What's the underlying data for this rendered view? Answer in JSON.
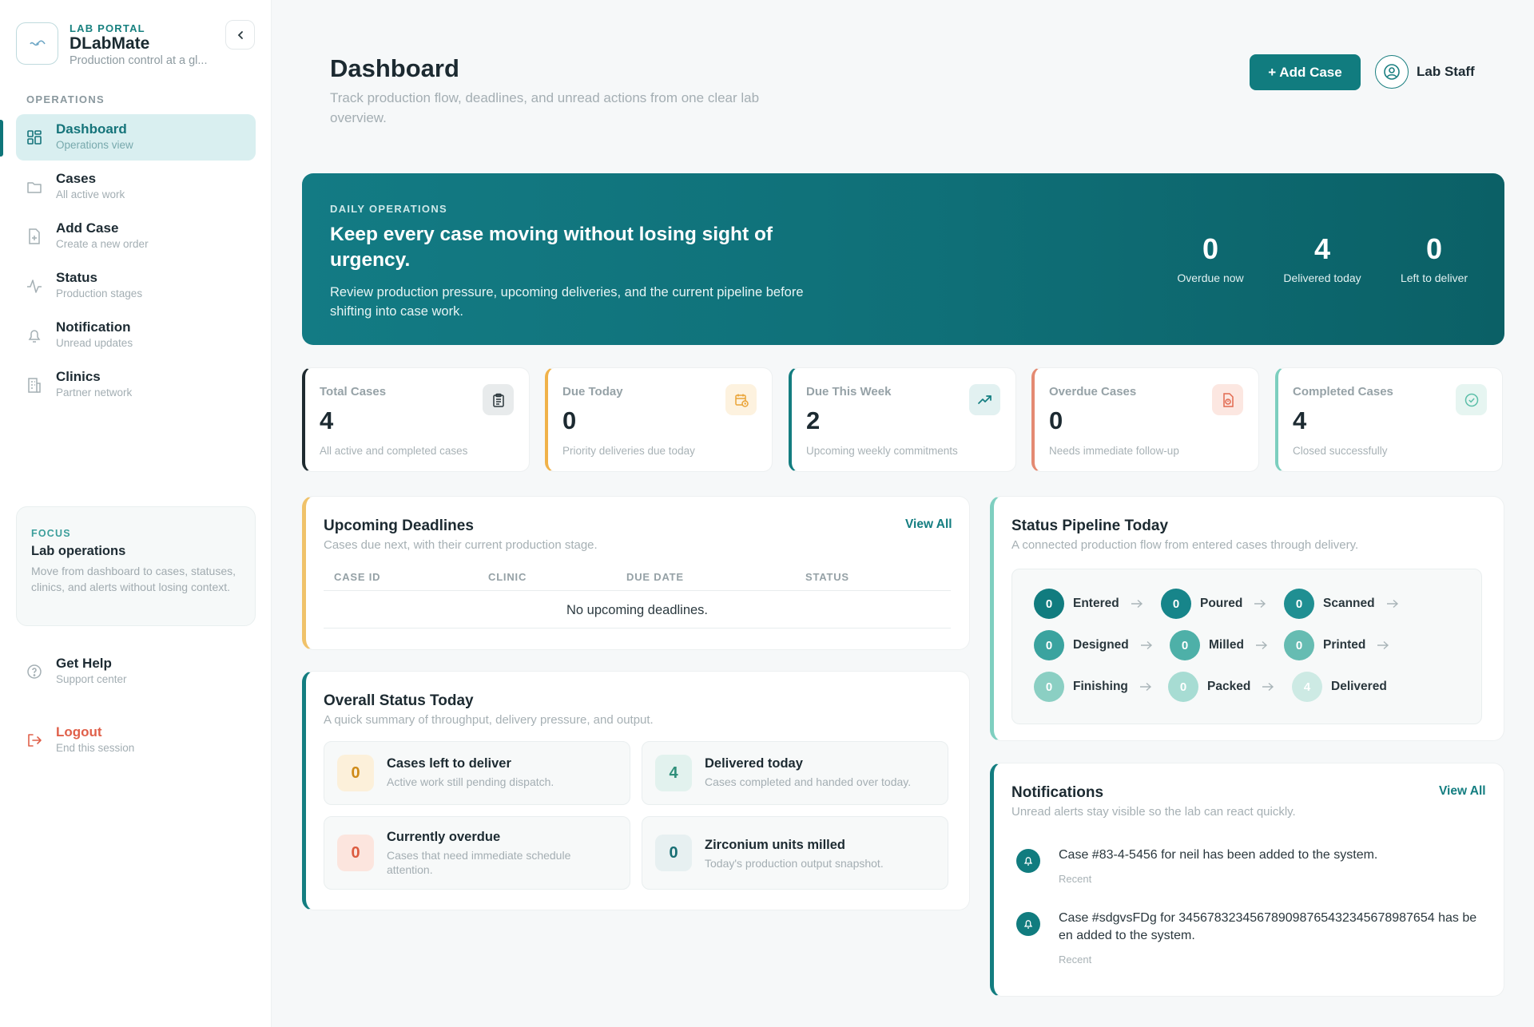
{
  "brand": {
    "kicker": "LAB PORTAL",
    "name": "DLabMate",
    "subtitle": "Production control at a gl..."
  },
  "sidebar": {
    "section_label": "OPERATIONS",
    "items": [
      {
        "title": "Dashboard",
        "subtitle": "Operations view",
        "icon": "grid-icon"
      },
      {
        "title": "Cases",
        "subtitle": "All active work",
        "icon": "folder-icon"
      },
      {
        "title": "Add Case",
        "subtitle": "Create a new order",
        "icon": "file-plus-icon"
      },
      {
        "title": "Status",
        "subtitle": "Production stages",
        "icon": "activity-icon"
      },
      {
        "title": "Notification",
        "subtitle": "Unread updates",
        "icon": "bell-icon"
      },
      {
        "title": "Clinics",
        "subtitle": "Partner network",
        "icon": "building-icon"
      }
    ],
    "focus": {
      "kicker": "FOCUS",
      "title": "Lab operations",
      "text": "Move from dashboard to cases, statuses, clinics, and alerts without losing context."
    },
    "help": {
      "title": "Get Help",
      "subtitle": "Support center"
    },
    "logout": {
      "title": "Logout",
      "subtitle": "End this session"
    }
  },
  "header": {
    "title": "Dashboard",
    "subtitle": "Track production flow, deadlines, and unread actions from one clear lab overview.",
    "add_case_label": "+ Add Case",
    "user_name": "Lab Staff"
  },
  "hero": {
    "kicker": "DAILY OPERATIONS",
    "title": "Keep every case moving without losing sight of urgency.",
    "text": "Review production pressure, upcoming deliveries, and the current pipeline before shifting into case work.",
    "stats": [
      {
        "value": "0",
        "label": "Overdue now"
      },
      {
        "value": "4",
        "label": "Delivered today"
      },
      {
        "value": "0",
        "label": "Left to deliver"
      }
    ]
  },
  "stat_cards": [
    {
      "label": "Total Cases",
      "value": "4",
      "note": "All active and completed cases",
      "accent": "#1f2b30",
      "icon": "clipboard-icon"
    },
    {
      "label": "Due Today",
      "value": "0",
      "note": "Priority deliveries due today",
      "accent": "#f0b24a",
      "icon": "calendar-clock-icon"
    },
    {
      "label": "Due This Week",
      "value": "2",
      "note": "Upcoming weekly commitments",
      "accent": "#137d80",
      "icon": "trending-up-icon"
    },
    {
      "label": "Overdue Cases",
      "value": "0",
      "note": "Needs immediate follow-up",
      "accent": "#e48a72",
      "icon": "alert-file-icon"
    },
    {
      "label": "Completed Cases",
      "value": "4",
      "note": "Closed successfully",
      "accent": "#7ccfbf",
      "icon": "check-circle-icon"
    }
  ],
  "deadlines": {
    "title": "Upcoming Deadlines",
    "subtitle": "Cases due next, with their current production stage.",
    "view_all": "View All",
    "columns": [
      "CASE ID",
      "CLINIC",
      "DUE DATE",
      "STATUS"
    ],
    "empty": "No upcoming deadlines."
  },
  "overall": {
    "title": "Overall Status Today",
    "subtitle": "A quick summary of throughput, delivery pressure, and output.",
    "cards": [
      {
        "value": "0",
        "title": "Cases left to deliver",
        "subtitle": "Active work still pending dispatch."
      },
      {
        "value": "4",
        "title": "Delivered today",
        "subtitle": "Cases completed and handed over today."
      },
      {
        "value": "0",
        "title": "Currently overdue",
        "subtitle": "Cases that need immediate schedule attention."
      },
      {
        "value": "0",
        "title": "Zirconium units milled",
        "subtitle": "Today's production output snapshot."
      }
    ]
  },
  "pipeline": {
    "title": "Status Pipeline Today",
    "subtitle": "A connected production flow from entered cases through delivery.",
    "stages": [
      {
        "count": "0",
        "label": "Entered"
      },
      {
        "count": "0",
        "label": "Poured"
      },
      {
        "count": "0",
        "label": "Scanned"
      },
      {
        "count": "0",
        "label": "Designed"
      },
      {
        "count": "0",
        "label": "Milled"
      },
      {
        "count": "0",
        "label": "Printed"
      },
      {
        "count": "0",
        "label": "Finishing"
      },
      {
        "count": "0",
        "label": "Packed"
      },
      {
        "count": "4",
        "label": "Delivered"
      }
    ]
  },
  "notifications": {
    "title": "Notifications",
    "subtitle": "Unread alerts stay visible so the lab can react quickly.",
    "view_all": "View All",
    "items": [
      {
        "text": "Case #83-4-5456 for neil has been added to the system.",
        "time": "Recent"
      },
      {
        "text": "Case #sdgvsFDg for 3456783234567890987654323456789876​54 has been added to the system.",
        "time": "Recent"
      }
    ]
  }
}
